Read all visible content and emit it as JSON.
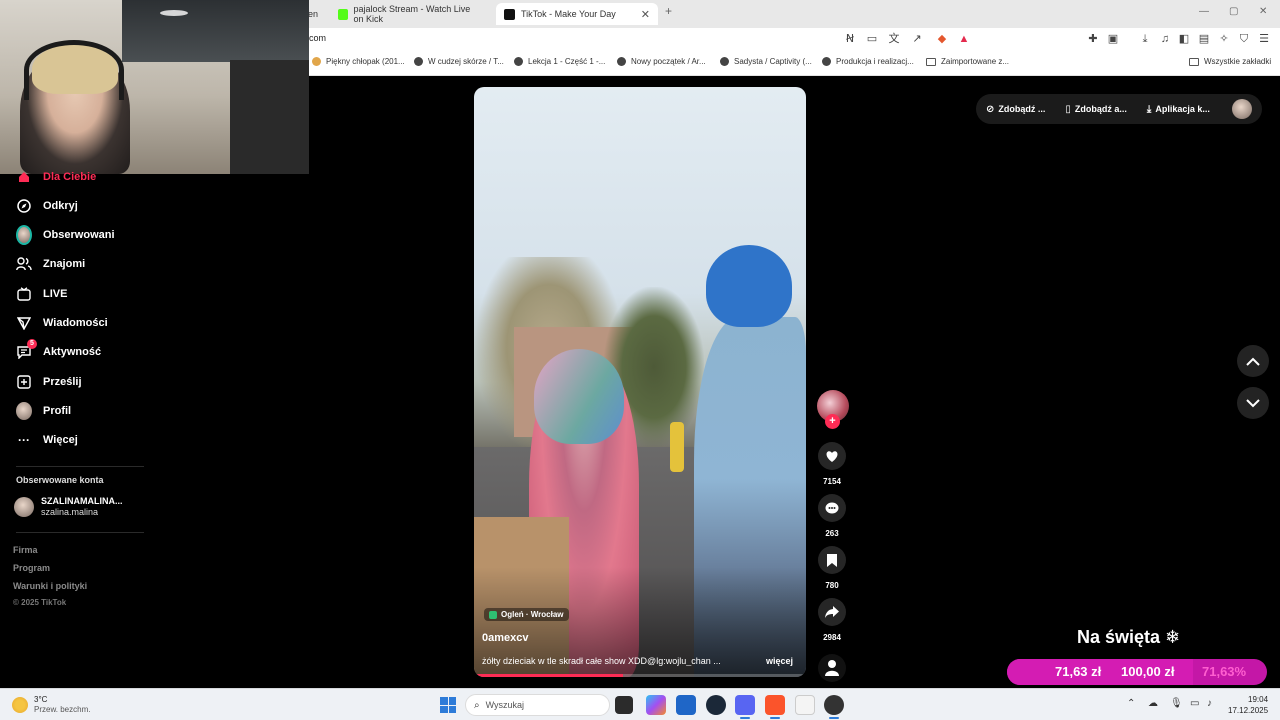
{
  "browser": {
    "tabs": [
      {
        "label": "en",
        "active": false
      },
      {
        "label": "pajalock Stream - Watch Live on Kick",
        "active": false
      },
      {
        "label": "TikTok - Make Your Day",
        "active": true
      }
    ],
    "url": "com",
    "bookmarks": [
      "Piękny chłopak (201...",
      "W cudzej skórze / T...",
      "Lekcja 1 - Część 1 -...",
      "Nowy początek / Ar...",
      "Sadysta / Captivity (...",
      "Produkcja i realizacj...",
      "Zaimportowane z..."
    ],
    "all_bookmarks": "Wszystkie zakładki"
  },
  "sidebar": {
    "items": [
      {
        "label": "Dla Ciebie",
        "icon": "home-icon",
        "active": true
      },
      {
        "label": "Odkryj",
        "icon": "compass-icon"
      },
      {
        "label": "Obserwowani",
        "icon": "avatar"
      },
      {
        "label": "Znajomi",
        "icon": "people-icon"
      },
      {
        "label": "LIVE",
        "icon": "live-tv-icon"
      },
      {
        "label": "Wiadomości",
        "icon": "send-icon"
      },
      {
        "label": "Aktywność",
        "icon": "inbox-icon",
        "badge": "5"
      },
      {
        "label": "Prześlij",
        "icon": "plus-square-icon"
      },
      {
        "label": "Profil",
        "icon": "avatar"
      },
      {
        "label": "Więcej",
        "icon": "ellipsis-icon"
      }
    ],
    "followed_title": "Obserwowane konta",
    "followed": {
      "name": "SZALINAMALINA...",
      "handle": "szalina.malina"
    },
    "footer": [
      "Firma",
      "Program",
      "Warunki i polityki"
    ],
    "copyright": "© 2025 TikTok"
  },
  "video": {
    "location": "Ogleń · Wrocław",
    "author": "0amexcv",
    "caption": "żółty dzieciak w tle skradł całe show XDD@lg:wojlu_chan ...",
    "more": "więcej",
    "progress": 0.45
  },
  "actions": {
    "likes": "7154",
    "comments": "263",
    "saves": "780",
    "shares": "2984"
  },
  "topbar": {
    "btn1": "Zdobądź ...",
    "btn2": "Zdobądź a...",
    "btn3": "Aplikacja k..."
  },
  "donation": {
    "title": "Na święta ❄",
    "current": "71,63 zł",
    "goal": "100,00 zł",
    "percent": "71,63%",
    "fraction": 0.7163
  },
  "taskbar": {
    "temp": "3°C",
    "weather": "Przew. bezchm.",
    "search_placeholder": "Wyszukaj",
    "time": "19:04",
    "date": "17.12.2025"
  },
  "colors": {
    "accent": "#fe2c55",
    "donation": "#d41cb3"
  }
}
